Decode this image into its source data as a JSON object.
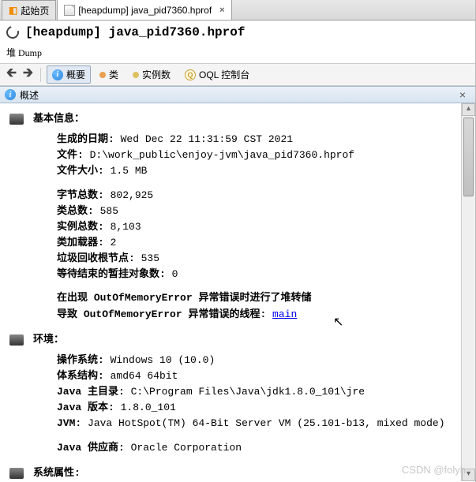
{
  "tabs": {
    "start": "起始页",
    "file": "[heapdump] java_pid7360.hprof"
  },
  "header": {
    "title": "[heapdump] java_pid7360.hprof",
    "subtitle": "堆 Dump"
  },
  "toolbar": {
    "overview": "概要",
    "classes": "类",
    "instances": "实例数",
    "oql": "OQL 控制台"
  },
  "outline": {
    "title": "概述"
  },
  "sections": {
    "basic": {
      "title": "基本信息：",
      "date_k": "生成的日期:",
      "date_v": "Wed Dec 22 11:31:59 CST 2021",
      "file_k": "文件:",
      "file_v": "D:\\work_public\\enjoy-jvm\\java_pid7360.hprof",
      "size_k": "文件大小:",
      "size_v": "1.5 MB",
      "bytes_k": "字节总数:",
      "bytes_v": "802,925",
      "cls_k": "类总数:",
      "cls_v": "585",
      "inst_k": "实例总数:",
      "inst_v": "8,103",
      "loader_k": "类加载器:",
      "loader_v": "2",
      "gcroot_k": "垃圾回收根节点:",
      "gcroot_v": "535",
      "pending_k": "等待结束的暂挂对象数:",
      "pending_v": "0",
      "oom1_a": "在出现 ",
      "oom1_b": "OutOfMemoryError",
      "oom1_c": " 异常错误时进行了堆转储",
      "oom2_a": "导致 ",
      "oom2_b": "OutOfMemoryError",
      "oom2_c": " 异常错误的线程: ",
      "oom2_link": "main"
    },
    "env": {
      "title": "环境：",
      "os_k": "操作系统:",
      "os_v": "Windows 10 (10.0)",
      "arch_k": "体系结构:",
      "arch_v": "amd64 64bit",
      "home_k": "Java 主目录:",
      "home_v": "C:\\Program Files\\Java\\jdk1.8.0_101\\jre",
      "ver_k": "Java 版本:",
      "ver_v": "1.8.0_101",
      "jvm_k": "JVM:",
      "jvm_v": "Java HotSpot(TM) 64-Bit Server VM (25.101-b13, mixed mode)",
      "vendor_k": "Java 供应商:",
      "vendor_v": "Oracle Corporation"
    },
    "sys": {
      "title": "系统属性:"
    }
  },
  "watermark": "CSDN @folyh"
}
